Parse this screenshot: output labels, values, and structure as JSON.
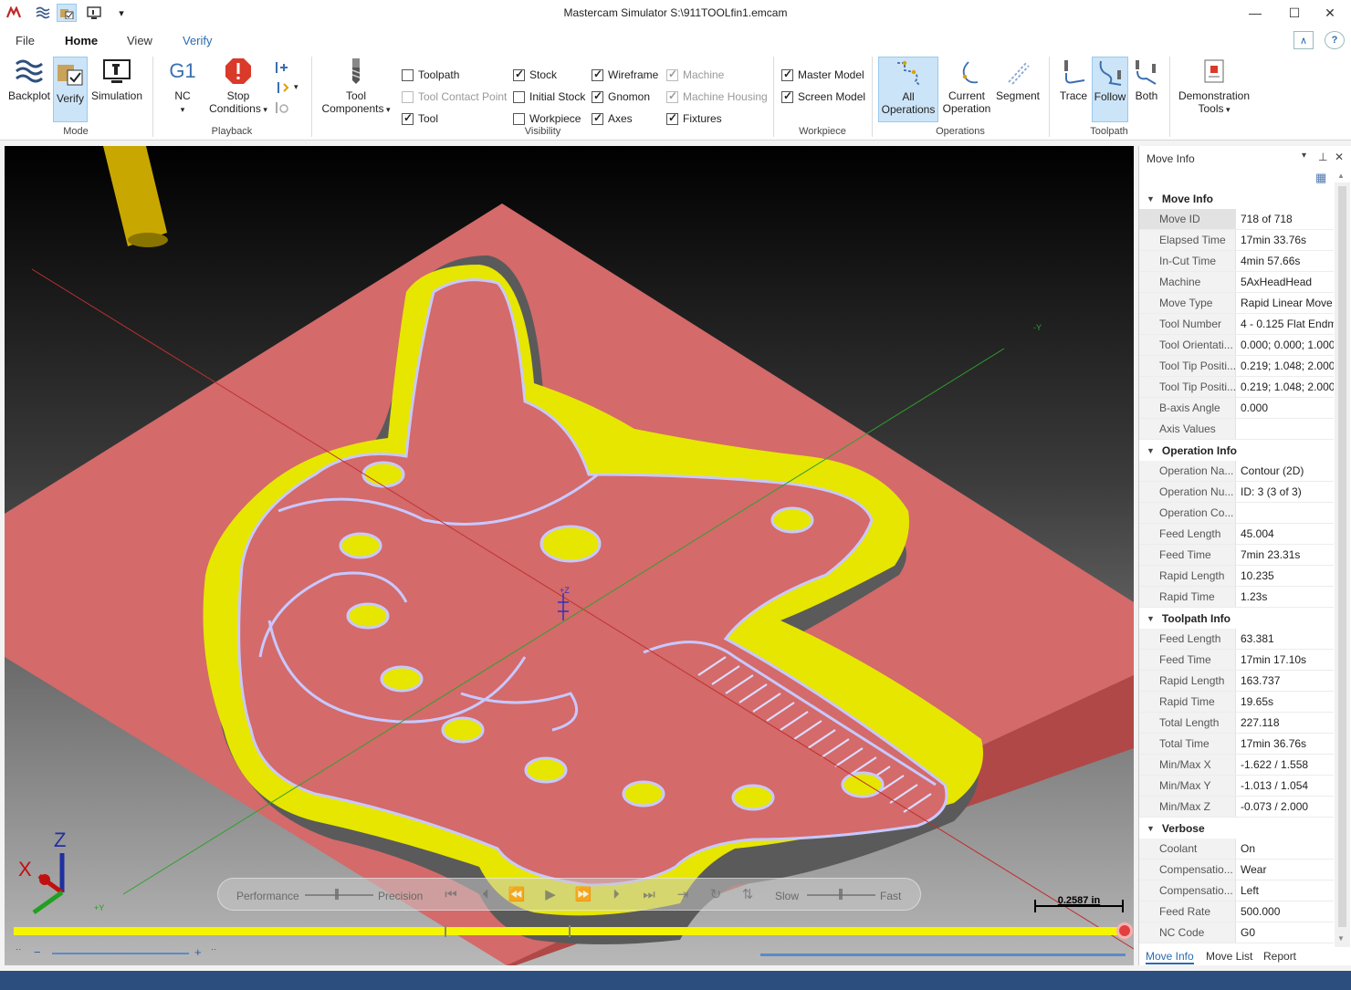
{
  "window": {
    "title": "Mastercam Simulator  S:\\911TOOLfin1.emcam",
    "quick_access_dropdown": "▾"
  },
  "menu": {
    "tabs": [
      {
        "label": "File"
      },
      {
        "label": "Home"
      },
      {
        "label": "View"
      },
      {
        "label": "Verify"
      }
    ]
  },
  "ribbon": {
    "mode": {
      "group_label": "Mode",
      "backplot": "Backplot",
      "verify": "Verify",
      "simulation": "Simulation"
    },
    "playback": {
      "group_label": "Playback",
      "nc_icon": "G1",
      "nc": "NC",
      "stop_conditions_1": "Stop",
      "stop_conditions_2": "Conditions"
    },
    "visibility": {
      "group_label": "Visibility",
      "tool_components_1": "Tool",
      "tool_components_2": "Components",
      "checkboxes": [
        {
          "label": "Toolpath",
          "checked": false,
          "disabled": false
        },
        {
          "label": "Tool Contact Point",
          "checked": false,
          "disabled": true
        },
        {
          "label": "Tool",
          "checked": true,
          "disabled": false
        },
        {
          "label": "Stock",
          "checked": true,
          "disabled": false
        },
        {
          "label": "Initial Stock",
          "checked": false,
          "disabled": false
        },
        {
          "label": "Workpiece",
          "checked": false,
          "disabled": false
        },
        {
          "label": "Wireframe",
          "checked": true,
          "disabled": false
        },
        {
          "label": "Gnomon",
          "checked": true,
          "disabled": false
        },
        {
          "label": "Axes",
          "checked": true,
          "disabled": false
        },
        {
          "label": "Machine",
          "checked": true,
          "disabled": true
        },
        {
          "label": "Machine Housing",
          "checked": true,
          "disabled": true
        },
        {
          "label": "Fixtures",
          "checked": true,
          "disabled": false
        }
      ]
    },
    "workpiece": {
      "group_label": "Workpiece",
      "checkboxes": [
        {
          "label": "Master Model",
          "checked": true
        },
        {
          "label": "Screen Model",
          "checked": true
        }
      ]
    },
    "operations": {
      "group_label": "Operations",
      "all_1": "All",
      "all_2": "Operations",
      "current_1": "Current",
      "current_2": "Operation",
      "segment": "Segment"
    },
    "toolpath": {
      "group_label": "Toolpath",
      "trace": "Trace",
      "follow": "Follow",
      "both": "Both"
    },
    "demo": {
      "label_1": "Demonstration",
      "label_2": "Tools"
    }
  },
  "viewport": {
    "axis_label_y": "-Y",
    "origin_label": "+Z",
    "gnomon": {
      "x": "X",
      "z": "Z",
      "y": "+Y"
    },
    "playbar": {
      "performance": "Performance",
      "precision": "Precision",
      "slow": "Slow",
      "fast": "Fast"
    },
    "scale_label": "0.2587 in",
    "progress_fraction": 1.0,
    "zoom": {
      "minus": "−",
      "plus": "+"
    }
  },
  "panel": {
    "title": "Move Info",
    "sections": [
      {
        "title": "Move Info",
        "rows": [
          {
            "k": "Move ID",
            "v": "718 of 718"
          },
          {
            "k": "Elapsed Time",
            "v": "17min 33.76s"
          },
          {
            "k": "In-Cut Time",
            "v": "4min 57.66s"
          },
          {
            "k": "Machine",
            "v": "5AxHeadHead"
          },
          {
            "k": "Move Type",
            "v": "Rapid Linear Move"
          },
          {
            "k": "Tool Number",
            "v": "4 - 0.125 Flat Endm"
          },
          {
            "k": "Tool Orientati...",
            "v": "0.000; 0.000; 1.000"
          },
          {
            "k": "Tool Tip Positi...",
            "v": "0.219; 1.048; 2.000"
          },
          {
            "k": "Tool Tip Positi...",
            "v": "0.219; 1.048; 2.000"
          },
          {
            "k": "B-axis Angle",
            "v": "0.000"
          },
          {
            "k": "Axis Values",
            "v": ""
          }
        ]
      },
      {
        "title": "Operation Info",
        "rows": [
          {
            "k": "Operation Na...",
            "v": "Contour (2D)"
          },
          {
            "k": "Operation Nu...",
            "v": "ID: 3 (3 of 3)"
          },
          {
            "k": "Operation Co...",
            "v": ""
          },
          {
            "k": "Feed Length",
            "v": "45.004"
          },
          {
            "k": "Feed Time",
            "v": "7min 23.31s"
          },
          {
            "k": "Rapid Length",
            "v": "10.235"
          },
          {
            "k": "Rapid Time",
            "v": "1.23s"
          }
        ]
      },
      {
        "title": "Toolpath Info",
        "rows": [
          {
            "k": "Feed Length",
            "v": "63.381"
          },
          {
            "k": "Feed Time",
            "v": "17min 17.10s"
          },
          {
            "k": "Rapid Length",
            "v": "163.737"
          },
          {
            "k": "Rapid Time",
            "v": "19.65s"
          },
          {
            "k": "Total Length",
            "v": "227.118"
          },
          {
            "k": "Total Time",
            "v": "17min 36.76s"
          },
          {
            "k": "Min/Max X",
            "v": "-1.622 / 1.558"
          },
          {
            "k": "Min/Max Y",
            "v": "-1.013 / 1.054"
          },
          {
            "k": "Min/Max Z",
            "v": "-0.073 / 2.000"
          }
        ]
      },
      {
        "title": "Verbose",
        "rows": [
          {
            "k": "Coolant",
            "v": "On"
          },
          {
            "k": "Compensatio...",
            "v": "Wear"
          },
          {
            "k": "Compensatio...",
            "v": "Left"
          },
          {
            "k": "Feed Rate",
            "v": "500.000"
          },
          {
            "k": "NC Code",
            "v": "G0"
          }
        ]
      }
    ],
    "tabs": [
      {
        "label": "Move Info"
      },
      {
        "label": "Move List"
      },
      {
        "label": "Report"
      }
    ]
  },
  "colors": {
    "stock": "#d46a6a",
    "wall": "#e6e600",
    "toolpath": "#c8c8ff",
    "accent": "#2b6cb0"
  }
}
